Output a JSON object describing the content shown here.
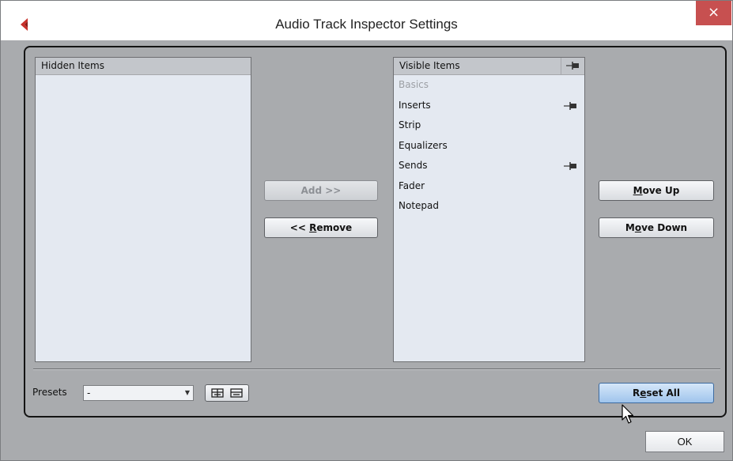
{
  "window": {
    "title": "Audio Track Inspector Settings",
    "close_glyph": "×",
    "app_icon": "cubase-logo-icon"
  },
  "hidden_list": {
    "header": "Hidden Items",
    "items": []
  },
  "visible_list": {
    "header": "Visible Items",
    "header_icon": "pin-icon",
    "items": [
      {
        "label": "Basics",
        "enabled": false,
        "pinned": false
      },
      {
        "label": "Inserts",
        "enabled": true,
        "pinned": true
      },
      {
        "label": "Strip",
        "enabled": true,
        "pinned": false
      },
      {
        "label": "Equalizers",
        "enabled": true,
        "pinned": false
      },
      {
        "label": "Sends",
        "enabled": true,
        "pinned": true
      },
      {
        "label": "Fader",
        "enabled": true,
        "pinned": false
      },
      {
        "label": "Notepad",
        "enabled": true,
        "pinned": false
      }
    ]
  },
  "buttons": {
    "add": "Add >>",
    "remove_prefix": "<< ",
    "remove_accel": "R",
    "remove_rest": "emove",
    "move_up_accel": "M",
    "move_up_rest": "ove Up",
    "move_down_pre": "M",
    "move_down_accel": "o",
    "move_down_rest": "ve Down",
    "reset_pre": "R",
    "reset_accel": "e",
    "reset_rest": "set All",
    "ok": "OK"
  },
  "presets": {
    "label": "Presets",
    "selected": "-",
    "save_icon": "save-preset-icon",
    "remove_icon": "remove-preset-icon"
  },
  "colors": {
    "panel_bg": "#a9abae",
    "list_bg": "#e4e9f1",
    "close_bg": "#c75050",
    "reset_hover": "#9fc4ec"
  }
}
